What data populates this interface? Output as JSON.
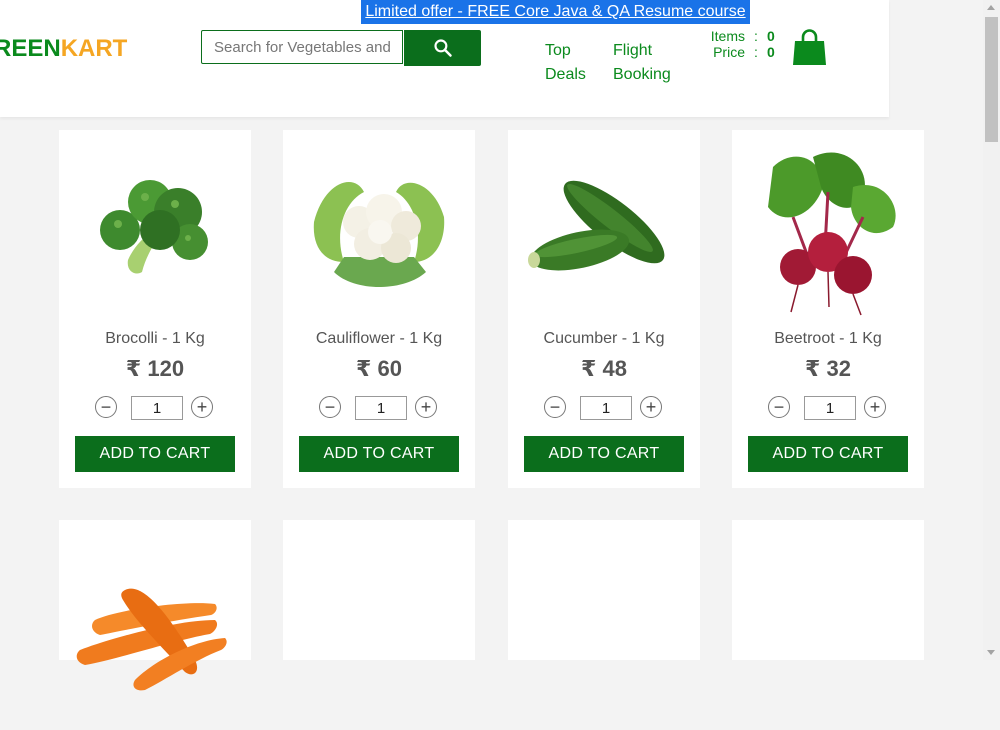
{
  "header": {
    "offer_text": "Limited offer - FREE Core Java & QA Resume course",
    "brand_part1": "REEN",
    "brand_part2": "KART",
    "search_placeholder": "Search for Vegetables and Fruits",
    "nav": [
      {
        "line1": "Top",
        "line2": "Deals"
      },
      {
        "line1": "Flight",
        "line2": "Booking"
      }
    ],
    "cart": {
      "items_label": "Items",
      "items_value": "0",
      "price_label": "Price",
      "price_value": "0",
      "separator": ":"
    }
  },
  "products": [
    {
      "name": "Brocolli - 1 Kg",
      "price": "₹ 120",
      "qty": "1",
      "add_label": "ADD TO CART",
      "image": "broccoli-image"
    },
    {
      "name": "Cauliflower - 1 Kg",
      "price": "₹ 60",
      "qty": "1",
      "add_label": "ADD TO CART",
      "image": "cauliflower-image"
    },
    {
      "name": "Cucumber - 1 Kg",
      "price": "₹ 48",
      "qty": "1",
      "add_label": "ADD TO CART",
      "image": "cucumber-image"
    },
    {
      "name": "Beetroot - 1 Kg",
      "price": "₹ 32",
      "qty": "1",
      "add_label": "ADD TO CART",
      "image": "beetroot-image"
    }
  ],
  "stepper": {
    "minus": "−",
    "plus": "+"
  },
  "colors": {
    "brand_green": "#0b8a1d",
    "brand_orange": "#f5a623",
    "button_green": "#0b6e1c",
    "offer_blue": "#1a73e8"
  }
}
